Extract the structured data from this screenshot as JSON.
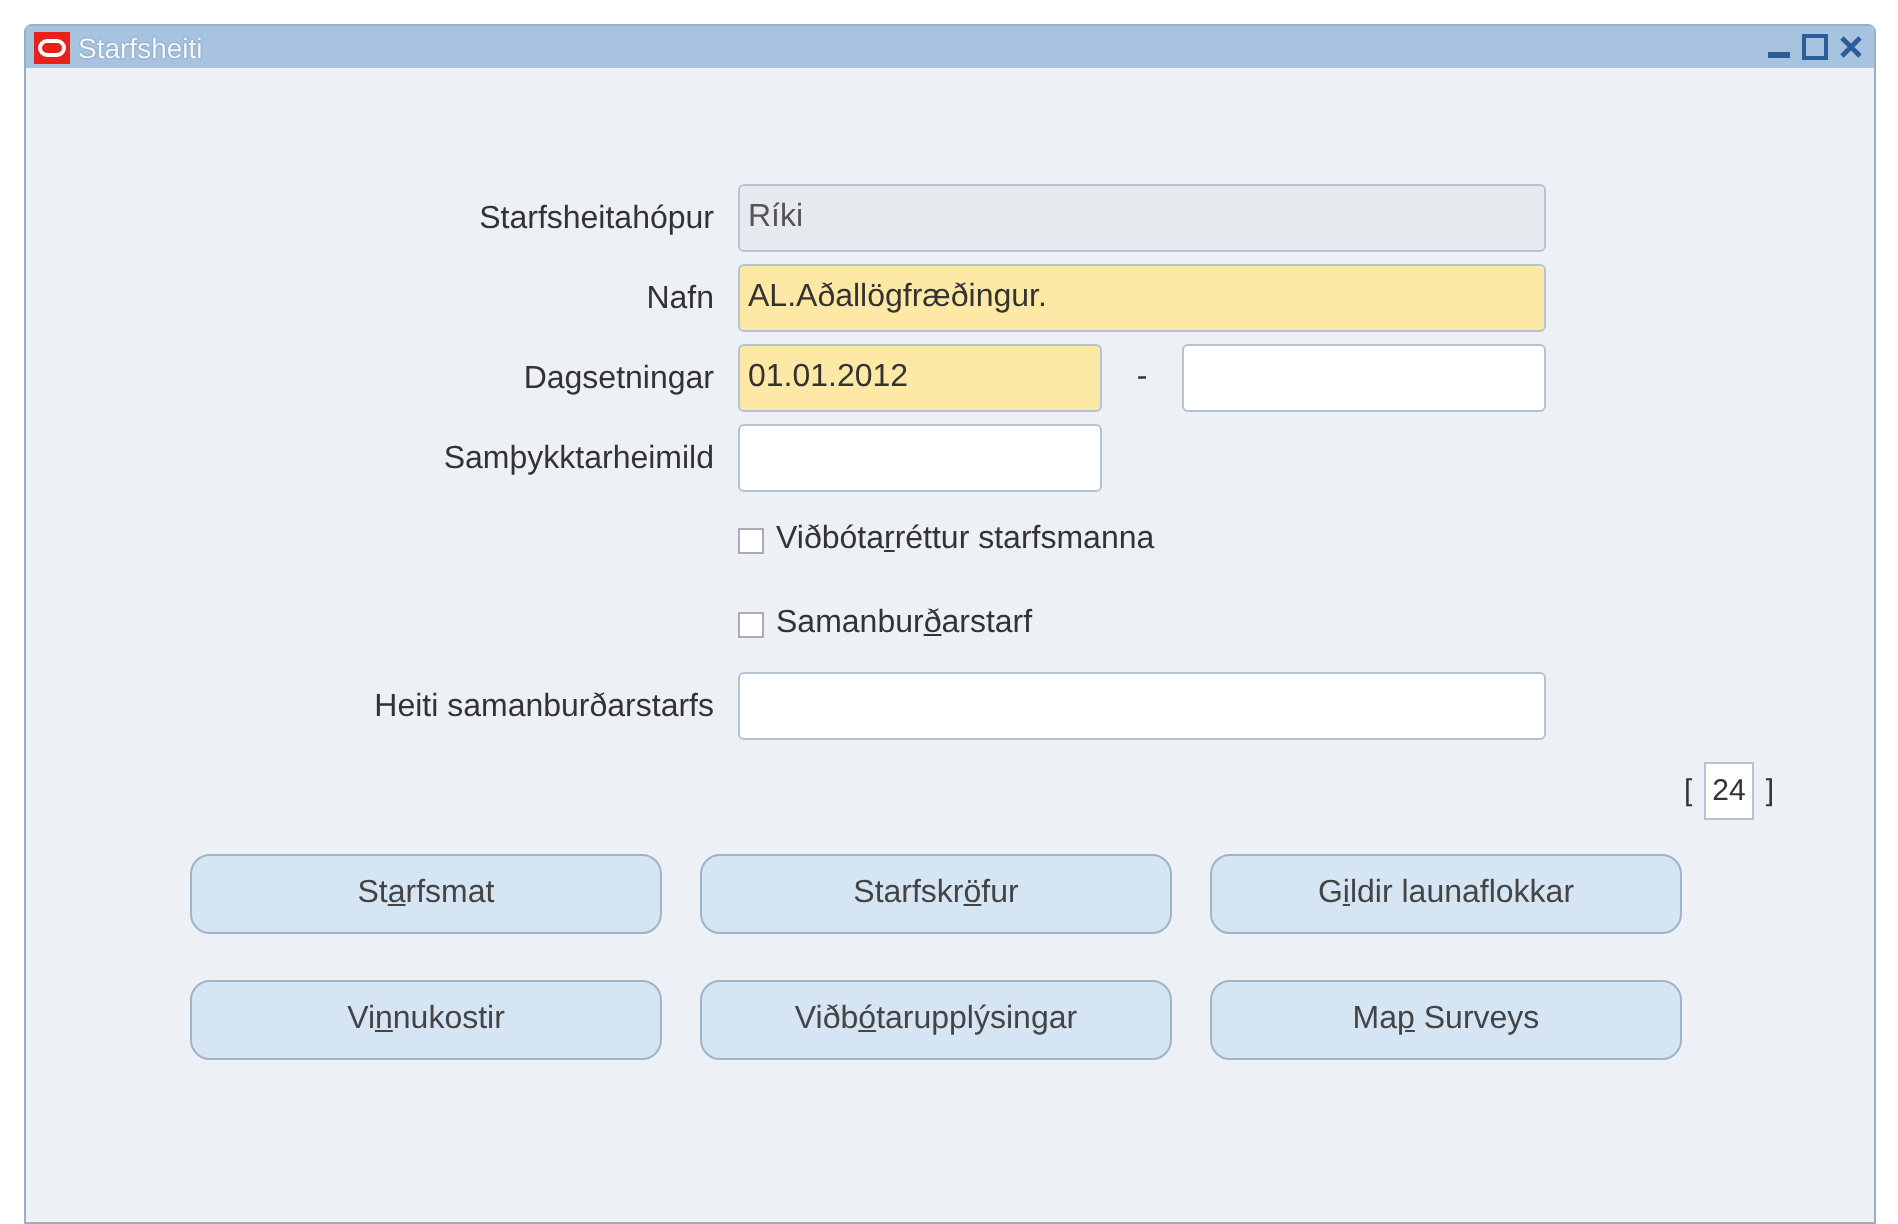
{
  "window": {
    "title": "Starfsheiti"
  },
  "fields": [
    {
      "label": "Starfsheitahópur",
      "kind": "readonly",
      "value": "Ríki"
    },
    {
      "label": "Nafn",
      "kind": "required",
      "value": "AL.Aðallögfræðingur."
    },
    {
      "label": "Dagsetningar",
      "kind": "range",
      "value": "01.01.2012",
      "separator": "-"
    },
    {
      "label": "Samþykktarheimild",
      "kind": "short"
    }
  ],
  "checkboxes": [
    {
      "before": "Viðbóta",
      "key": "r",
      "after": "réttur starfsmanna",
      "checked": false
    },
    {
      "before": "Samanbur",
      "key": "ð",
      "after": "arstarf",
      "checked": false
    }
  ],
  "comparison_field": {
    "label": "Heiti samanburðarstarfs"
  },
  "counter": {
    "open": "[",
    "value": "24",
    "close": "]"
  },
  "buttons": [
    {
      "before": "St",
      "key": "a",
      "after": "rfsmat"
    },
    {
      "before": "Starfskr",
      "key": "ö",
      "after": "fur"
    },
    {
      "before": "G",
      "key": "i",
      "after": "ldir launaflokkar"
    },
    {
      "before": "Vi",
      "key": "n",
      "after": "nukostir"
    },
    {
      "before": "Viðb",
      "key": "ó",
      "after": "tarupplýsingar"
    },
    {
      "before": "Ma",
      "key": "p",
      "after": " Surveys"
    }
  ]
}
